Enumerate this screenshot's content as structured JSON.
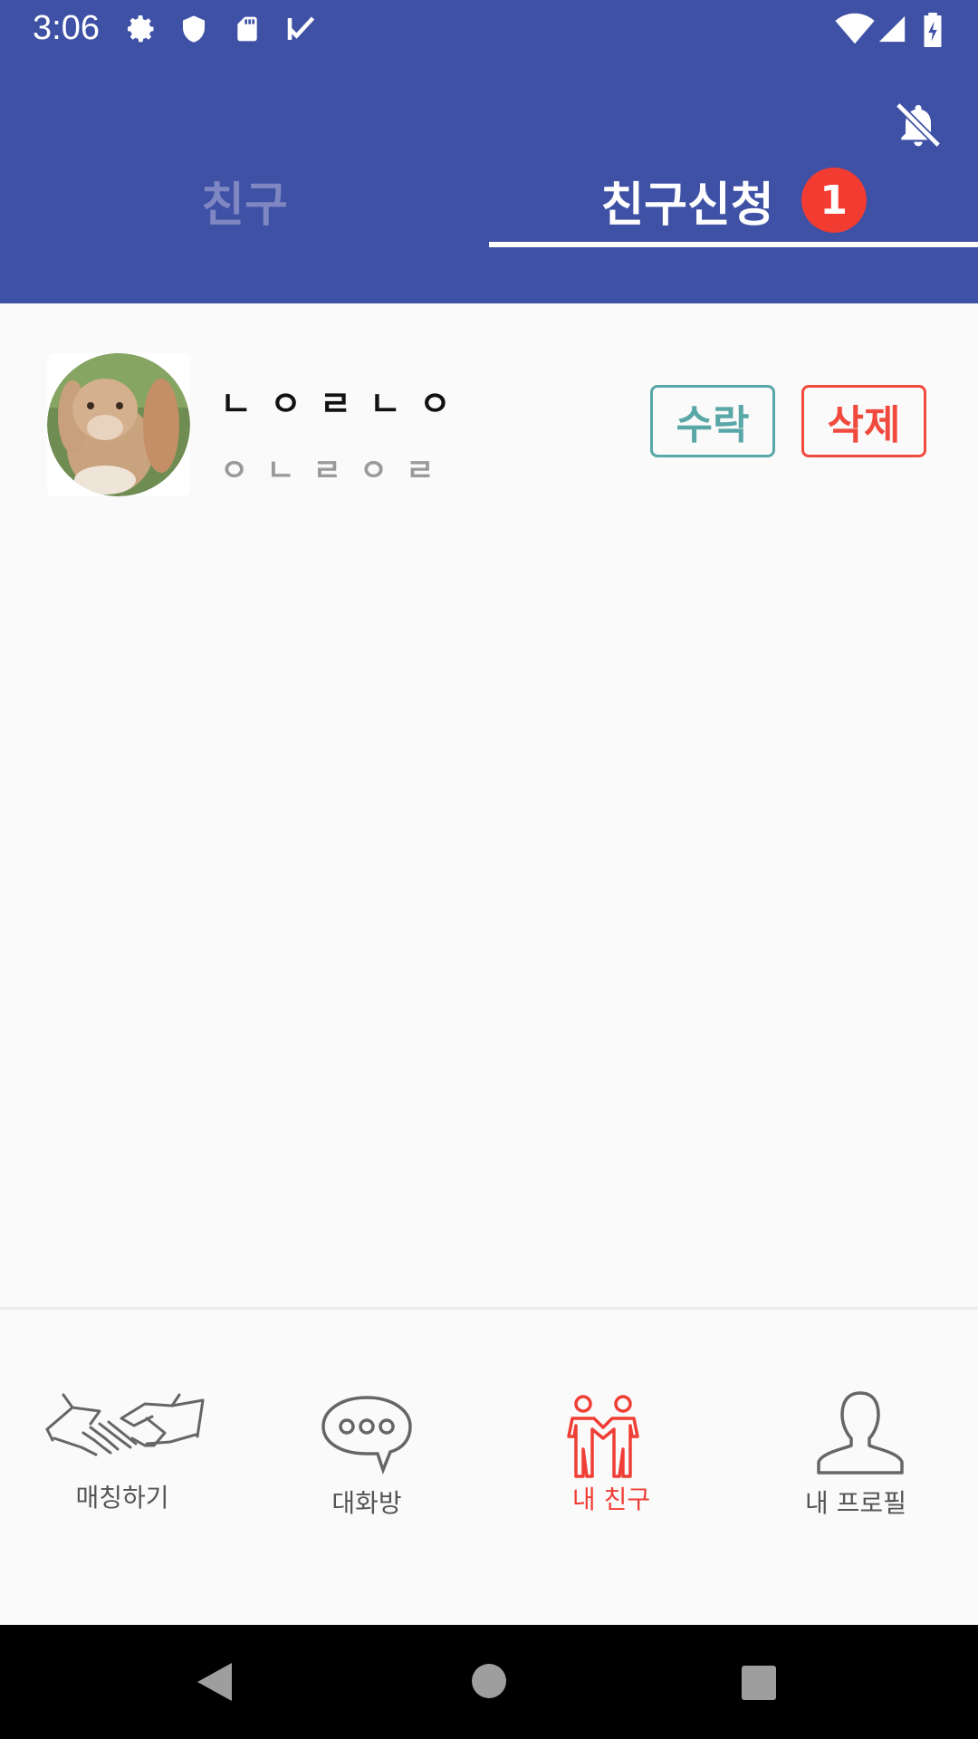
{
  "status_bar": {
    "time": "3:06",
    "icons": [
      "gear-icon",
      "shield-icon",
      "sd-card-icon",
      "checklist-icon",
      "wifi-icon",
      "signal-icon",
      "battery-icon"
    ]
  },
  "app_bar": {
    "color": "#3f51a5",
    "notification_icon": "bell-off-icon"
  },
  "tabs": [
    {
      "label": "친구",
      "active": false
    },
    {
      "label": "친구신청",
      "active": true,
      "badge": "1"
    }
  ],
  "friend_requests": [
    {
      "name": "ㄴㅇㄹㄴㅇ",
      "subtitle": "ㅇㄴㄹㅇㄹ",
      "avatar": "rabbit-photo",
      "accept_label": "수락",
      "delete_label": "삭제"
    }
  ],
  "bottom_nav": [
    {
      "label": "매칭하기",
      "icon": "handshake-icon",
      "active": false
    },
    {
      "label": "대화방",
      "icon": "chat-bubble-icon",
      "active": false
    },
    {
      "label": "내 친구",
      "icon": "friends-icon",
      "active": true
    },
    {
      "label": "내 프로필",
      "icon": "person-icon",
      "active": false
    }
  ],
  "system_nav": [
    "back-icon",
    "home-icon",
    "recents-icon"
  ],
  "colors": {
    "primary": "#3f51a5",
    "accent_red": "#f23c32",
    "accept_teal": "#5aa7a7",
    "inactive_tab": "#7f87c2"
  }
}
